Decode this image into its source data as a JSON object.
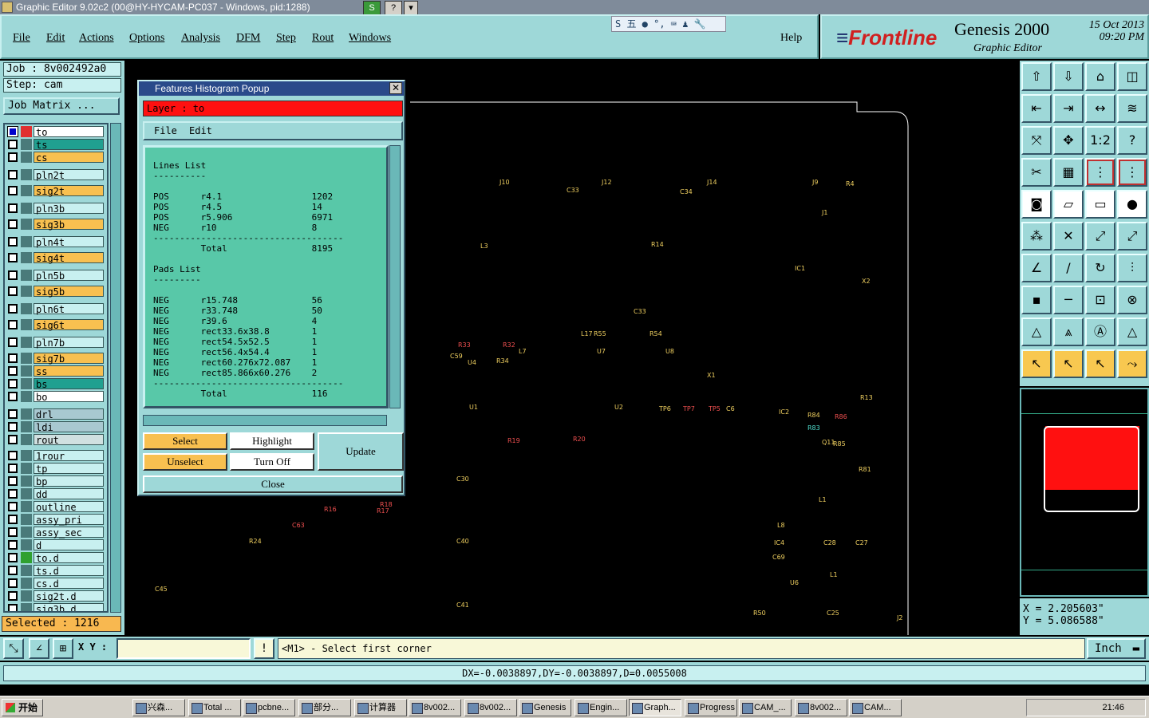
{
  "window": {
    "title": "Graphic Editor 9.02c2 (00@HY-HYCAM-PC037 - Windows, pid:1288)"
  },
  "menu": [
    "File",
    "Edit",
    "Actions",
    "Options",
    "Analysis",
    "DFM",
    "Step",
    "Rout",
    "Windows"
  ],
  "help": "Help",
  "ime": "S 五 ● °, ⌨ ♟ 🔧",
  "brand": {
    "logo_a": "Frontline",
    "product": "Genesis 2000",
    "module": "Graphic Editor",
    "date": "15 Oct 2013",
    "time": "09:20 PM"
  },
  "job": {
    "job": "Job : 8v002492a0",
    "step": "Step: cam",
    "matrix": "Job Matrix ..."
  },
  "layers": [
    {
      "name": "to",
      "color": "#ffffff",
      "state": "on",
      "mark": "red"
    },
    {
      "name": "ts",
      "color": "#20a090"
    },
    {
      "name": "cs",
      "color": "#f8c050"
    },
    {
      "name": "pln2t",
      "color": "#c8f0f0"
    },
    {
      "name": "sig2t",
      "color": "#f8c050"
    },
    {
      "name": "pln3b",
      "color": "#c8f0f0"
    },
    {
      "name": "sig3b",
      "color": "#f8c050"
    },
    {
      "name": "pln4t",
      "color": "#c8f0f0"
    },
    {
      "name": "sig4t",
      "color": "#f8c050"
    },
    {
      "name": "pln5b",
      "color": "#c8f0f0"
    },
    {
      "name": "sig5b",
      "color": "#f8c050"
    },
    {
      "name": "pln6t",
      "color": "#c8f0f0"
    },
    {
      "name": "sig6t",
      "color": "#f8c050"
    },
    {
      "name": "pln7b",
      "color": "#c8f0f0"
    },
    {
      "name": "sig7b",
      "color": "#f8c050"
    },
    {
      "name": "ss",
      "color": "#f8c050"
    },
    {
      "name": "bs",
      "color": "#20a090"
    },
    {
      "name": "bo",
      "color": "#ffffff"
    },
    {
      "name": "drl",
      "color": "#a8c8d0"
    },
    {
      "name": "ldi",
      "color": "#a8c8d0"
    },
    {
      "name": "rout",
      "color": "#d0e0e0"
    },
    {
      "name": "1rour",
      "color": "#c8f0f0"
    },
    {
      "name": "tp",
      "color": "#c8f0f0"
    },
    {
      "name": "bp",
      "color": "#c8f0f0"
    },
    {
      "name": "dd",
      "color": "#c8f0f0"
    },
    {
      "name": "outline",
      "color": "#c8f0f0"
    },
    {
      "name": "assy_pri",
      "color": "#c8f0f0"
    },
    {
      "name": "assy_sec",
      "color": "#c8f0f0"
    },
    {
      "name": "d",
      "color": "#c8f0f0"
    },
    {
      "name": "to.d",
      "color": "#c8f0f0",
      "mark": "green"
    },
    {
      "name": "ts.d",
      "color": "#c8f0f0"
    },
    {
      "name": "cs.d",
      "color": "#c8f0f0"
    },
    {
      "name": "sig2t.d",
      "color": "#c8f0f0"
    },
    {
      "name": "sig3b.d",
      "color": "#c8f0f0"
    }
  ],
  "selected": "Selected : 1216",
  "popup": {
    "title": "Features Histogram Popup",
    "layer": "Layer :  to",
    "menu": [
      "File",
      "Edit"
    ],
    "lines": [
      "Lines List",
      "----------",
      "",
      "POS      r4.1                 1202",
      "POS      r4.5                 14",
      "POS      r5.906               6971",
      "NEG      r10                  8",
      "------------------------------------",
      "         Total                8195",
      "",
      "Pads List",
      "---------",
      "",
      "NEG      r15.748              56",
      "NEG      r33.748              50",
      "NEG      r39.6                4",
      "NEG      rect33.6x38.8        1",
      "NEG      rect54.5x52.5        1",
      "NEG      rect56.4x54.4        1",
      "NEG      rect60.276x72.087    1",
      "NEG      rect85.866x60.276    2",
      "------------------------------------",
      "         Total                116"
    ],
    "buttons": {
      "select": "Select",
      "highlight": "Highlight",
      "unselect": "Unselect",
      "turnoff": "Turn Off",
      "update": "Update",
      "close": "Close"
    }
  },
  "refdes": [
    {
      "t": "J10",
      "c": "y"
    },
    {
      "t": "C33",
      "c": "y"
    },
    {
      "t": "J12",
      "c": "y"
    },
    {
      "t": "C34",
      "c": "y"
    },
    {
      "t": "J14",
      "c": "y"
    },
    {
      "t": "J9",
      "c": "y"
    },
    {
      "t": "R4",
      "c": "y"
    },
    {
      "t": "L3",
      "c": "y"
    },
    {
      "t": "R14",
      "c": "y"
    },
    {
      "t": "IC1",
      "c": "y"
    },
    {
      "t": "J1",
      "c": "y"
    },
    {
      "t": "X2",
      "c": "y"
    },
    {
      "t": "L17",
      "c": "y"
    },
    {
      "t": "R55",
      "c": "y"
    },
    {
      "t": "R54",
      "c": "y"
    },
    {
      "t": "U7",
      "c": "y"
    },
    {
      "t": "U8",
      "c": "y"
    },
    {
      "t": "C33",
      "c": "y"
    },
    {
      "t": "R33",
      "c": "r"
    },
    {
      "t": "R32",
      "c": "r"
    },
    {
      "t": "L7",
      "c": "y"
    },
    {
      "t": "C59",
      "c": "y"
    },
    {
      "t": "U4",
      "c": "y"
    },
    {
      "t": "R34",
      "c": "y"
    },
    {
      "t": "X1",
      "c": "y"
    },
    {
      "t": "U1",
      "c": "y"
    },
    {
      "t": "U2",
      "c": "y"
    },
    {
      "t": "TP6",
      "c": "y"
    },
    {
      "t": "TP7",
      "c": "r"
    },
    {
      "t": "TP5",
      "c": "r"
    },
    {
      "t": "C6",
      "c": "y"
    },
    {
      "t": "IC2",
      "c": "y"
    },
    {
      "t": "R13",
      "c": "y"
    },
    {
      "t": "R84",
      "c": "y"
    },
    {
      "t": "R86",
      "c": "r"
    },
    {
      "t": "R83",
      "c": "c"
    },
    {
      "t": "R19",
      "c": "r"
    },
    {
      "t": "R20",
      "c": "r"
    },
    {
      "t": "Q11",
      "c": "y"
    },
    {
      "t": "R85",
      "c": "y"
    },
    {
      "t": "C30",
      "c": "y"
    },
    {
      "t": "R81",
      "c": "y"
    },
    {
      "t": "R16",
      "c": "r"
    },
    {
      "t": "R18",
      "c": "r"
    },
    {
      "t": "R17",
      "c": "r"
    },
    {
      "t": "C63",
      "c": "r"
    },
    {
      "t": "R24",
      "c": "y"
    },
    {
      "t": "C40",
      "c": "y"
    },
    {
      "t": "L1",
      "c": "y"
    },
    {
      "t": "L8",
      "c": "y"
    },
    {
      "t": "IC4",
      "c": "y"
    },
    {
      "t": "C28",
      "c": "y"
    },
    {
      "t": "C27",
      "c": "y"
    },
    {
      "t": "C69",
      "c": "y"
    },
    {
      "t": "L1",
      "c": "y"
    },
    {
      "t": "U6",
      "c": "y"
    },
    {
      "t": "C45",
      "c": "y"
    },
    {
      "t": "C41",
      "c": "y"
    },
    {
      "t": "R50",
      "c": "y"
    },
    {
      "t": "C25",
      "c": "y"
    },
    {
      "t": "J2",
      "c": "y"
    }
  ],
  "tools": [
    "⇧",
    "⇩",
    "⌂",
    "◫",
    "⇤",
    "⇥",
    "↔",
    "≋",
    "⤧",
    "✥",
    "1:2",
    "?",
    "✂",
    "▦",
    "⋮",
    "⋮",
    "◙",
    "▱",
    "▭",
    "●",
    "⁂",
    "✕",
    "⤢",
    "⤢",
    "∠",
    "/",
    "↻",
    "⫶",
    "▪",
    "─",
    "⊡",
    "⊗",
    "△",
    "⩓",
    "Ⓐ",
    "△",
    "↖",
    "↖",
    "↖",
    "⤳"
  ],
  "coords": {
    "x": "X = 2.205603\"",
    "y": "Y = 5.086588\""
  },
  "cmd": {
    "xy_label": "X Y :",
    "prompt": "<M1> - Select first corner",
    "unit": "Inch",
    "info_icon": "!"
  },
  "status": "DX=-0.0038897,DY=-0.0038897,D=0.0055008",
  "taskbar": {
    "start": "开始",
    "tasks": [
      "兴森...",
      "Total ...",
      "pcbne...",
      "部分...",
      "计算器",
      "8v002...",
      "8v002...",
      "Genesis",
      "Engin...",
      "Graph...",
      "Progress",
      "CAM_...",
      "8v002...",
      "CAM..."
    ],
    "clock": "21:46"
  }
}
